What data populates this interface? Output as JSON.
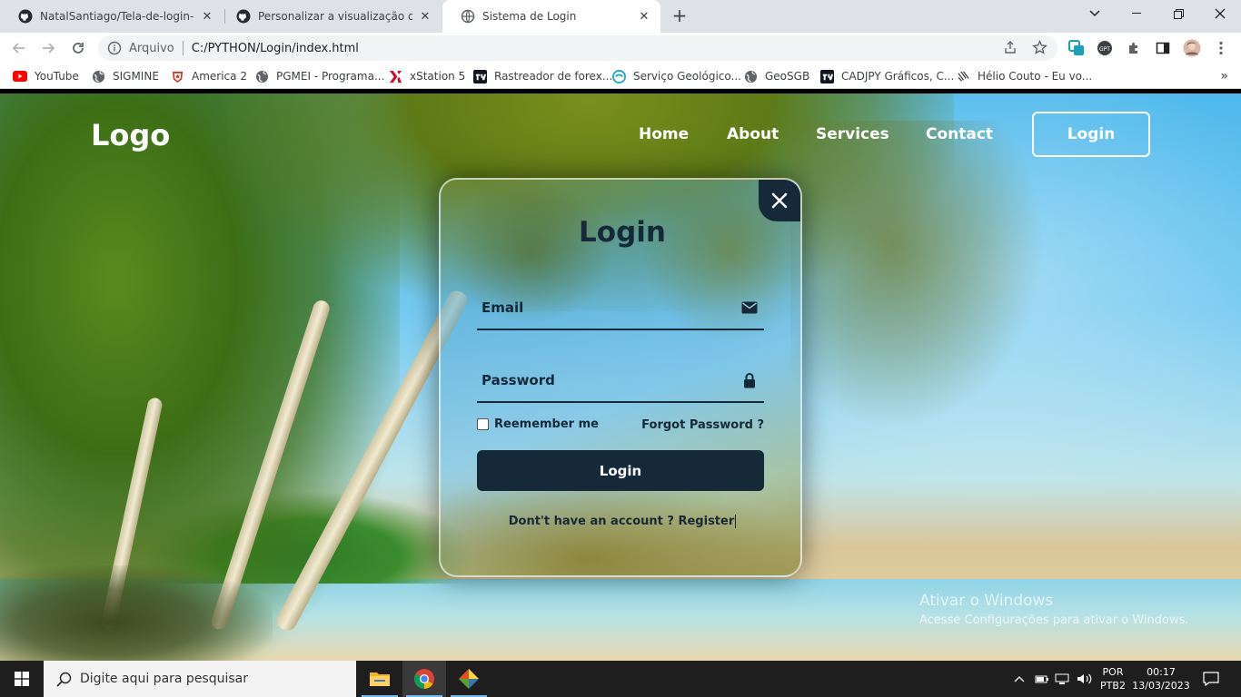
{
  "browser": {
    "tabs": [
      {
        "title": "NatalSantiago/Tela-de-login-com",
        "icon": "github-icon",
        "active": false
      },
      {
        "title": "Personalizar a visualização de mi",
        "icon": "github-icon",
        "active": false
      },
      {
        "title": "Sistema de Login",
        "icon": "globe-icon",
        "active": true
      }
    ],
    "new_tab": "+",
    "address": {
      "scheme": "Arquivo",
      "url": "C:/PYTHON/Login/index.html"
    },
    "bookmarks": [
      {
        "label": "YouTube",
        "icon": "youtube-icon"
      },
      {
        "label": "SIGMINE",
        "icon": "globe-icon"
      },
      {
        "label": "America 2",
        "icon": "america-icon"
      },
      {
        "label": "PGMEI - Programa...",
        "icon": "globe-icon"
      },
      {
        "label": "xStation 5",
        "icon": "xstation-icon"
      },
      {
        "label": "Rastreador de forex...",
        "icon": "tradingview-icon"
      },
      {
        "label": "Serviço Geológico...",
        "icon": "geology-icon"
      },
      {
        "label": "GeoSGB",
        "icon": "globe-icon"
      },
      {
        "label": "CADJPY Gráficos, C...",
        "icon": "tradingview-icon"
      },
      {
        "label": "Hélio Couto - Eu vo...",
        "icon": "helio-icon"
      }
    ],
    "bookmarks_more": "»"
  },
  "site": {
    "logo": "Logo",
    "nav": {
      "home": "Home",
      "about": "About",
      "services": "Services",
      "contact": "Contact"
    },
    "nav_login": "Login"
  },
  "login_card": {
    "title": "Login",
    "email_label": "Email",
    "password_label": "Password",
    "remember_label": "Reemember me",
    "forgot_label": "Forgot Password ?",
    "submit_label": "Login",
    "register_prompt": "Dont't have an account ?",
    "register_link": "Register"
  },
  "watermark": {
    "title": "Ativar o Windows",
    "subtitle": "Acesse Configurações para ativar o Windows."
  },
  "taskbar": {
    "search_placeholder": "Digite aqui para pesquisar",
    "language": "POR",
    "layout": "PTB2",
    "time": "00:17",
    "date": "13/03/2023"
  },
  "colors": {
    "card_dark": "#162938",
    "tabstrip": "#dee1e6",
    "taskbar": "#1e1e1e"
  }
}
